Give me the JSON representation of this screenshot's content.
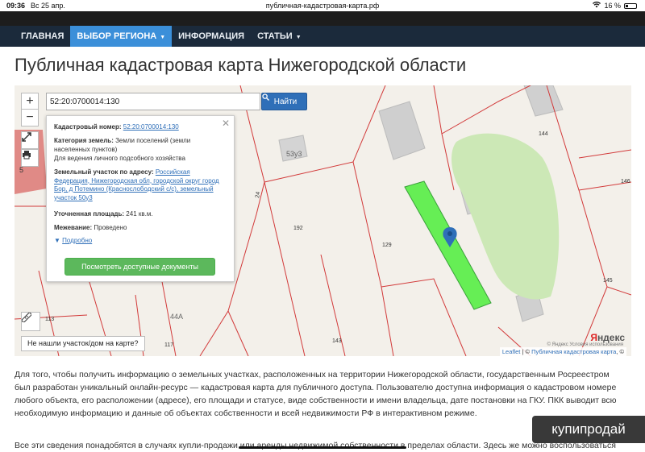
{
  "status_bar": {
    "time": "09:36",
    "date": "Вс 25 апр.",
    "url": "публичная-кадастровая-карта.рф",
    "battery": "16 %"
  },
  "nav": {
    "items": [
      {
        "label": "ГЛАВНАЯ"
      },
      {
        "label": "ВЫБОР РЕГИОНА"
      },
      {
        "label": "ИНФОРМАЦИЯ"
      },
      {
        "label": "СТАТЬИ"
      }
    ]
  },
  "page_title": "Публичная кадастровая карта Нижегородской области",
  "map": {
    "zoom_in": "+",
    "zoom_out": "−",
    "search_value": "52:20:0700014:130",
    "search_button": "Найти",
    "parcel_labels": {
      "l53": "53у3",
      "l144": "144",
      "l146": "146",
      "l145": "145",
      "l192": "192",
      "l129": "129",
      "l143": "143",
      "l117": "117",
      "l113": "113",
      "l44a": "44А",
      "l24": "24",
      "l5": "5"
    },
    "popup": {
      "close": "✕",
      "cad_label": "Кадастровый номер:",
      "cad_value": "52:20:0700014:130",
      "cat_label": "Категория земель:",
      "cat_value": "Земли поселений (земли населенных пунктов)",
      "use_value": "Для ведения личного подсобного хозяйства",
      "addr_label": "Земельный участок по адресу:",
      "addr_value": "Российская Федерация, Нижегородская обл, городской округ город Бор, д Потемино (Краснослободский с/с), земельный участок 50у3",
      "area_label": "Уточненная площадь:",
      "area_value": "241 кв.м.",
      "survey_label": "Межевание:",
      "survey_value": "Проведено",
      "more": "Подробно",
      "docs_button": "Посмотреть доступные документы"
    },
    "not_found": "Не нашли участок/дом на карте?",
    "yandex_y": "Я",
    "yandex_rest": "ндекс",
    "terms": "© Яндекс  Условия использования",
    "attribution_leaflet": "Leaflet",
    "attribution_site": "Публичная кадастровая карта",
    "attribution_sep1": " | © ",
    "attribution_sep2": ", ©"
  },
  "body": {
    "paragraph1": "Для того, чтобы получить информацию о земельных участках, расположенных на территории Нижегородской области, государственным Росреестром был разработан уникальный онлайн-ресурс — кадастровая карта для публичного доступа. Пользователю доступна информация о кадастровом номере любого объекта, его расположении (адресе), его площади и статусе, виде собственности и имени владельца, дате постановки на ГКУ. ПКК выводит всю необходимую информацию и данные об объектах собственности и всей недвижимости РФ в интерактивном режиме.",
    "paragraph2": "Все эти сведения понадобятся в случаях купли-продажи или аренды недвижимой собственности в пределах области. Здесь же можно воспользоваться"
  },
  "watermark": "купипродай",
  "colors": {
    "nav_bg": "#1b2a3b",
    "nav_active": "#3b8fd9",
    "search_btn": "#2f6fb8",
    "docs_btn": "#5cb85c",
    "parcel_selected": "#66ee55",
    "parcel_lines": "#d23a3a"
  }
}
